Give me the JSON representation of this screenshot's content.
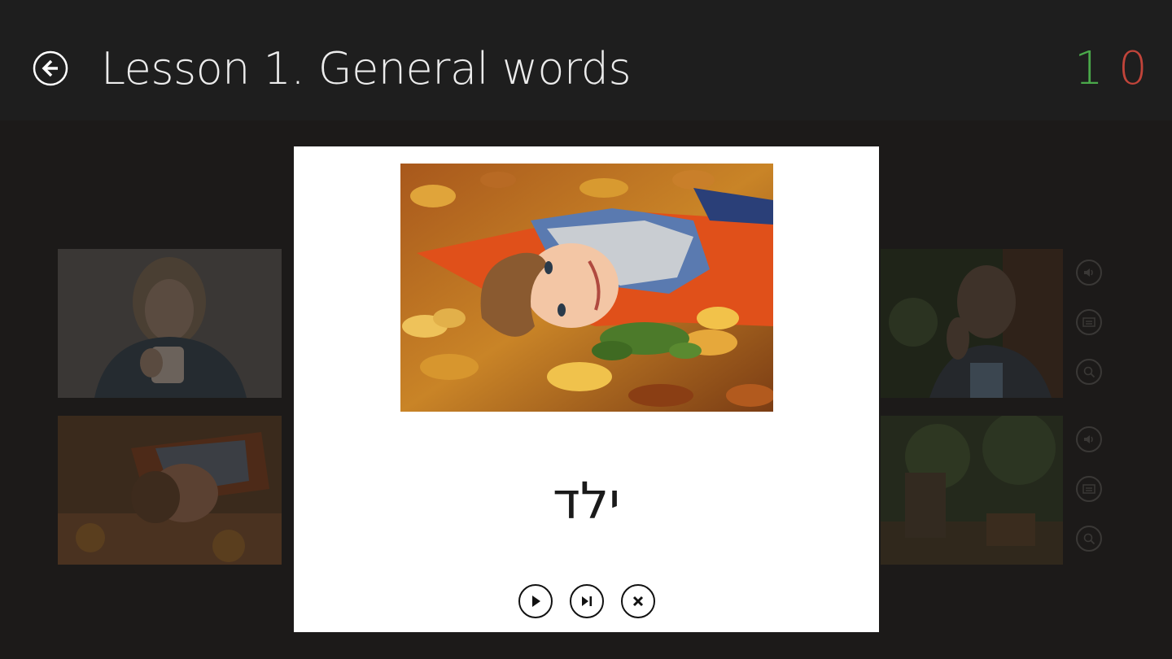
{
  "header": {
    "title": "Lesson 1. General words",
    "back_icon": "back-arrow-icon",
    "score": {
      "correct": "1",
      "wrong": "0"
    }
  },
  "colors": {
    "header_bg": "#1e1e1e",
    "stage_bg": "#1c1a19",
    "correct": "#4aa94a",
    "wrong": "#c1443a",
    "card_bg": "#ffffff"
  },
  "card": {
    "word": "ילד",
    "photo": "boy-lying-in-autumn-leaves",
    "controls": [
      {
        "name": "play-button",
        "icon": "play-icon"
      },
      {
        "name": "next-button",
        "icon": "skip-next-icon"
      },
      {
        "name": "close-button",
        "icon": "close-icon"
      }
    ]
  },
  "tiles": [
    {
      "name": "tile-woman-drinking",
      "icon_set": []
    },
    {
      "name": "tile-boy-leaves",
      "icon_set": []
    },
    {
      "name": "tile-man-phone",
      "icon_set": [
        "speaker-icon",
        "card-icon",
        "zoom-icon"
      ]
    },
    {
      "name": "tile-forest",
      "icon_set": [
        "speaker-icon",
        "card-icon",
        "zoom-icon"
      ]
    }
  ]
}
